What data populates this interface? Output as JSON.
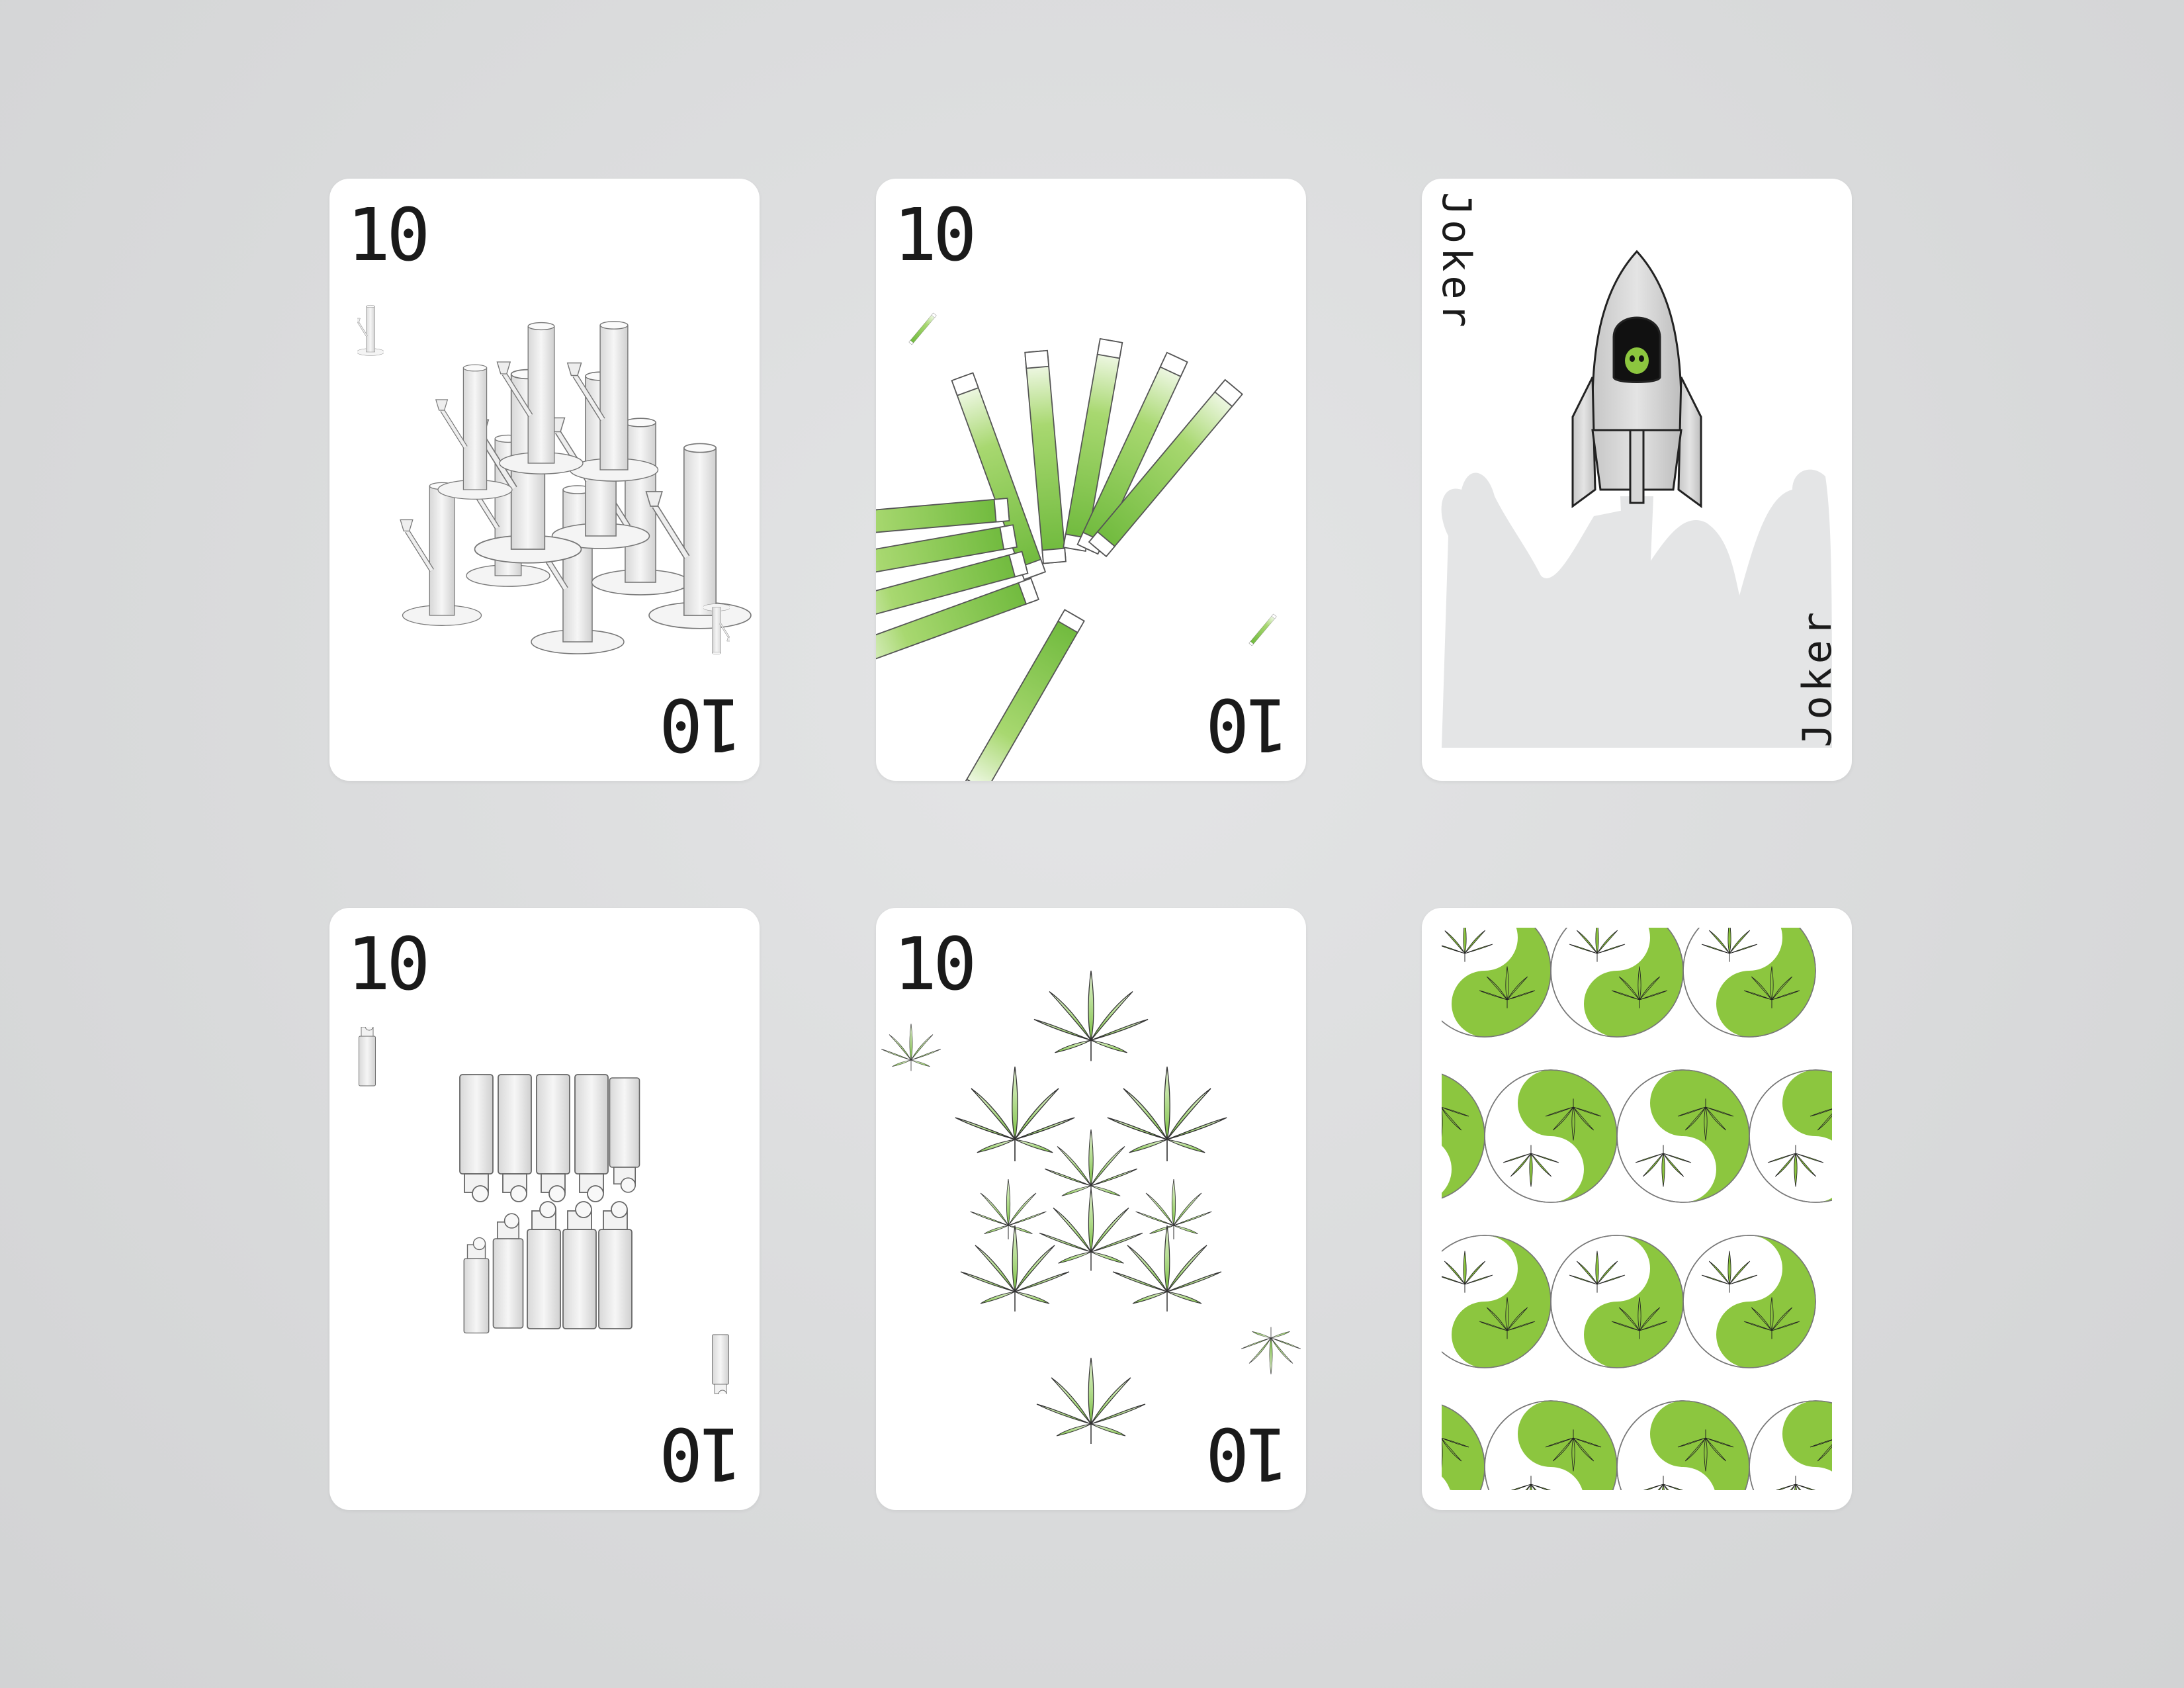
{
  "cards": [
    {
      "rank": "10",
      "suit": "bong-icon"
    },
    {
      "rank": "10",
      "suit": "joint-icon"
    },
    {
      "rank": "Joker",
      "suit": "rocket-icon"
    },
    {
      "rank": "10",
      "suit": "lighter-icon"
    },
    {
      "rank": "10",
      "suit": "leaf-icon"
    },
    {
      "rank": "",
      "suit": "yin-yang-leaf-pattern"
    }
  ],
  "colors": {
    "background": "#d9dadb",
    "card": "#ffffff",
    "accent_green": "#8cc63f",
    "glass_gray": "#e6e6e6",
    "smoke": "#e4e5e6"
  }
}
